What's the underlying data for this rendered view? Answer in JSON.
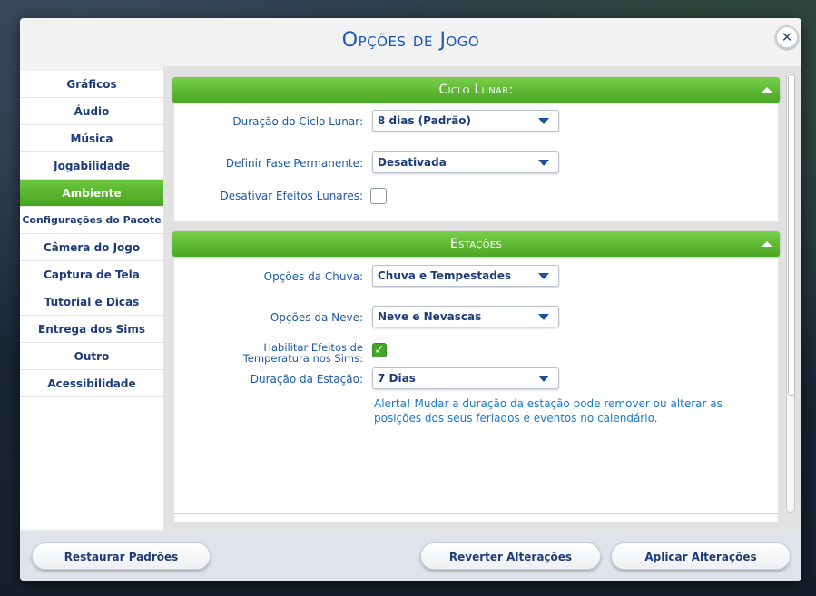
{
  "dialog": {
    "title": "Opções de Jogo"
  },
  "sidebar": {
    "items": [
      {
        "label": "Gráficos"
      },
      {
        "label": "Áudio"
      },
      {
        "label": "Música"
      },
      {
        "label": "Jogabilidade"
      },
      {
        "label": "Ambiente",
        "active": true
      },
      {
        "label": "Configurações do Pacote"
      },
      {
        "label": "Câmera do Jogo"
      },
      {
        "label": "Captura de Tela"
      },
      {
        "label": "Tutorial e Dicas"
      },
      {
        "label": "Entrega dos Sims"
      },
      {
        "label": "Outro"
      },
      {
        "label": "Acessibilidade"
      }
    ]
  },
  "lunar": {
    "header": "Ciclo Lunar:",
    "duration_label": "Duração do Ciclo Lunar:",
    "duration_value": "8 dias (Padrão)",
    "phase_label": "Definir Fase Permanente:",
    "phase_value": "Desativada",
    "effects_label": "Desativar Efeitos Lunares:",
    "effects_checked": false
  },
  "seasons": {
    "header": "Estações",
    "rain_label": "Opções da Chuva:",
    "rain_value": "Chuva e Tempestades",
    "snow_label": "Opções da Neve:",
    "snow_value": "Neve e Nevascas",
    "temp_label_line1": "Habilitar Efeitos de",
    "temp_label_line2": "Temperatura nos Sims:",
    "temp_checked": true,
    "duration_label": "Duração da Estação:",
    "duration_value": "7 Dias",
    "alert": "Alerta! Mudar a duração da estação pode remover ou alterar as posições dos seus feriados e eventos no calendário."
  },
  "footer": {
    "restore_label": "Restaurar Padrões",
    "revert_label": "Reverter Alterações",
    "apply_label": "Aplicar Alterações"
  },
  "colors": {
    "accent_green": "#4aa623",
    "title_blue": "#1c58b8",
    "text_navy": "#1d3c7a"
  }
}
